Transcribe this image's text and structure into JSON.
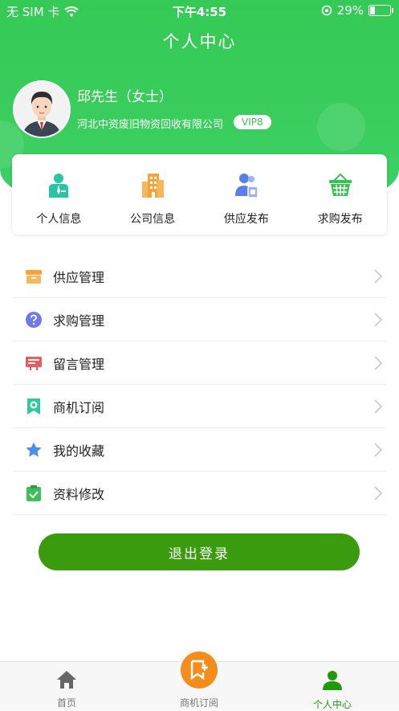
{
  "status": {
    "carrier": "无 SIM 卡",
    "time": "下午4:55",
    "battery": "29%",
    "battery_level": 0.29
  },
  "header": {
    "title": "个人中心"
  },
  "profile": {
    "name": "邱先生（女士）",
    "company": "河北中资废旧物资回收有限公司",
    "vip": "VIP8"
  },
  "quick_actions": [
    {
      "label": "个人信息",
      "icon": "user-id-icon",
      "color": "#29c3a6"
    },
    {
      "label": "公司信息",
      "icon": "building-icon",
      "color": "#f5a33d"
    },
    {
      "label": "供应发布",
      "icon": "users-publish-icon",
      "color": "#5b7fe6"
    },
    {
      "label": "求购发布",
      "icon": "shopping-basket-icon",
      "color": "#3dbf59"
    }
  ],
  "menu": [
    {
      "label": "供应管理",
      "icon": "box-icon",
      "color": "#f5a33d"
    },
    {
      "label": "求购管理",
      "icon": "question-icon",
      "color": "#6f79e8"
    },
    {
      "label": "留言管理",
      "icon": "message-board-icon",
      "color": "#ee5a5a"
    },
    {
      "label": "商机订阅",
      "icon": "subscribe-icon",
      "color": "#2fc9a0"
    },
    {
      "label": "我的收藏",
      "icon": "star-icon",
      "color": "#4a8ff0"
    },
    {
      "label": "资料修改",
      "icon": "clipboard-check-icon",
      "color": "#3dbf59"
    }
  ],
  "logout_label": "退出登录",
  "tabs": [
    {
      "label": "首页",
      "icon": "home-icon"
    },
    {
      "label": "商机订阅",
      "icon": "bookmark-plus-icon"
    },
    {
      "label": "个人中心",
      "icon": "person-icon",
      "active": true
    }
  ],
  "colors": {
    "primary": "#3dd064",
    "logout": "#3a9b0e",
    "accent_orange": "#f58d1d",
    "tab_active": "#1f9a0b"
  }
}
